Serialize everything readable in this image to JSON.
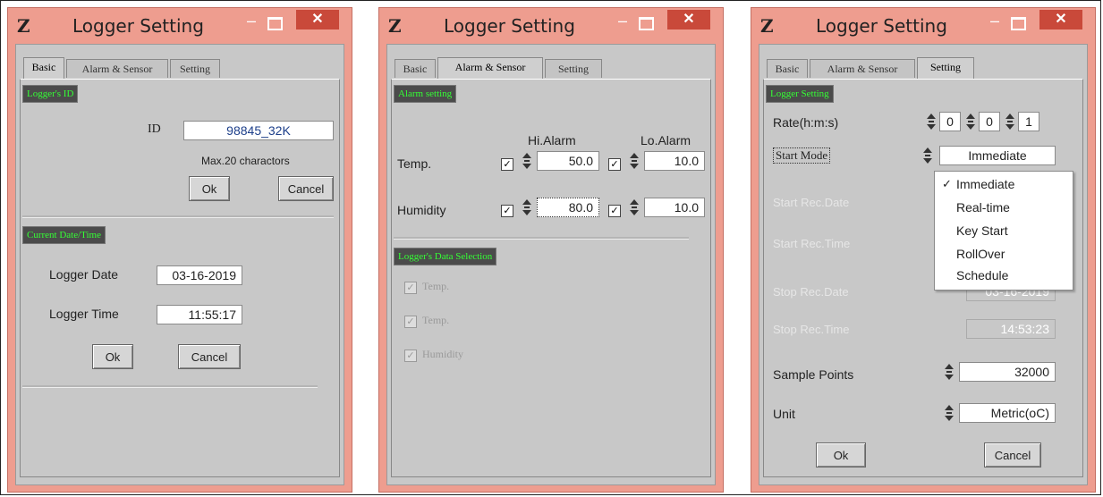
{
  "windows": [
    {
      "title": "Logger Setting",
      "tabs": [
        "Basic",
        "Alarm & Sensor",
        "Setting"
      ],
      "basic": {
        "logger_id_group": "Logger's ID",
        "id_label": "ID",
        "id_value": "98845_32K",
        "hint": "Max.20 charactors",
        "ok": "Ok",
        "cancel": "Cancel",
        "datetime_group": "Current Date/Time",
        "date_label": "Logger Date",
        "date_value": "03-16-2019",
        "time_label": "Logger Time",
        "time_value": "11:55:17",
        "ok2": "Ok",
        "cancel2": "Cancel"
      }
    },
    {
      "title": "Logger Setting",
      "tabs": [
        "Basic",
        "Alarm & Sensor",
        "Setting"
      ],
      "alarm": {
        "group": "Alarm setting",
        "hi_alarm": "Hi.Alarm",
        "lo_alarm": "Lo.Alarm",
        "temp_label": "Temp.",
        "temp_hi": "50.0",
        "temp_lo": "10.0",
        "humidity_label": "Humidity",
        "hum_hi": "80.0",
        "hum_lo": "10.0",
        "selection_group": "Logger's Data Selection",
        "sel_items": [
          "Temp.",
          "Temp.",
          "Humidity"
        ]
      }
    },
    {
      "title": "Logger Setting",
      "tabs": [
        "Basic",
        "Alarm & Sensor",
        "Setting"
      ],
      "setting": {
        "group": "Logger Setting",
        "rate_label": "Rate(h:m:s)",
        "rate_h": "0",
        "rate_m": "0",
        "rate_s": "1",
        "start_mode_label": "Start Mode",
        "start_mode_value": "Immediate",
        "start_date_label": "Start Rec.Date",
        "start_time_label": "Start Rec.Time",
        "stop_date_label": "Stop Rec.Date",
        "stop_date_value": "03-16-2019",
        "stop_time_label": "Stop Rec.Time",
        "stop_time_value": "14:53:23",
        "sample_label": "Sample Points",
        "sample_value": "32000",
        "unit_label": "Unit",
        "unit_value": "Metric(oC)",
        "ok": "Ok",
        "cancel": "Cancel",
        "dropdown_options": [
          "Immediate",
          "Real-time",
          "Key Start",
          "RollOver",
          "Schedule"
        ],
        "dropdown_selected": "Immediate"
      }
    }
  ],
  "icons": {
    "app": "Z",
    "minimize": "–",
    "close": "✕",
    "check": "✓"
  },
  "colors": {
    "titlebar": "#ee9d8f",
    "close": "#c9493a",
    "group_text": "#35ff35",
    "group_bg": "#4b4b4b",
    "client": "#c8c8c8"
  }
}
